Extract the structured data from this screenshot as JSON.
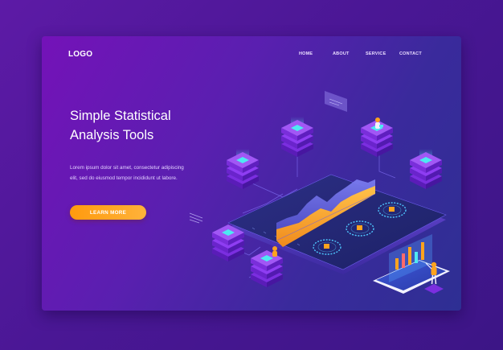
{
  "header": {
    "logo": "LOGO",
    "nav": [
      "HOME",
      "ABOUT",
      "SERVICE",
      "CONTACT"
    ]
  },
  "hero": {
    "title_lines": [
      "Simple Statistical",
      "Analysis Tools"
    ],
    "body_lines": [
      "Lorem ipsum dolor sit amet, consectetur adipiscing",
      "elit, sed do eiusmod tempor incididunt ut labore."
    ],
    "cta_label": "LEARN MORE"
  },
  "colors": {
    "page_background": "#4a1795",
    "card_gradient_start": "#7412b8",
    "card_gradient_end": "#2e2f93",
    "accent_orange": "#ffa31f",
    "server_cyan": "#4ee8f2",
    "server_purple": "#8a2fe0"
  },
  "illustration": {
    "icons": [
      "server-stack",
      "analytics-board",
      "area-chart",
      "donut-gauge",
      "smartphone",
      "person"
    ]
  }
}
